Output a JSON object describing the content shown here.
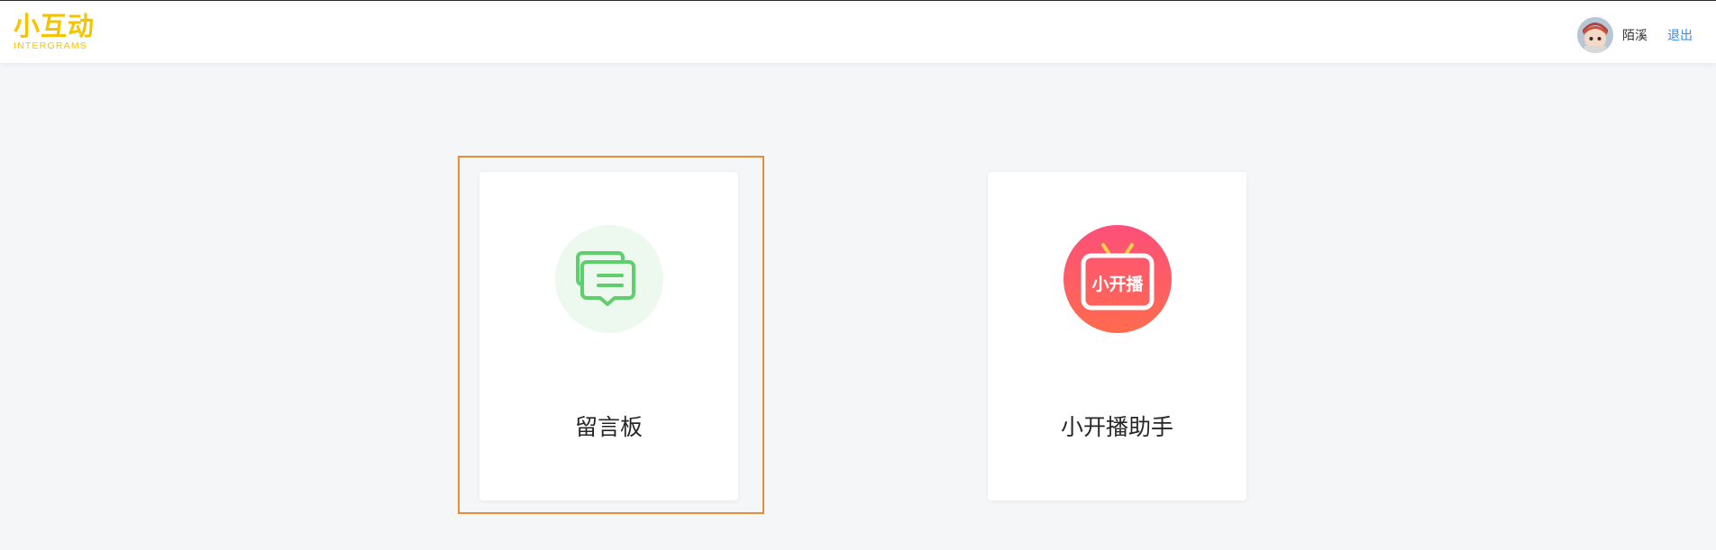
{
  "header": {
    "logo_main": "小互动",
    "logo_sub": "INTERGRAMS",
    "username": "陌溪",
    "logout_label": "退出"
  },
  "cards": [
    {
      "title": "留言板",
      "icon": "message-board-icon",
      "selected": true
    },
    {
      "title": "小开播助手",
      "icon": "tv-live-icon",
      "icon_text": "小开播"
    }
  ],
  "colors": {
    "brand": "#f5c400",
    "link": "#2d8cf0",
    "selection": "#ee8a33",
    "message_green": "#5fcf6e",
    "live_red": "#fe5a6c"
  }
}
